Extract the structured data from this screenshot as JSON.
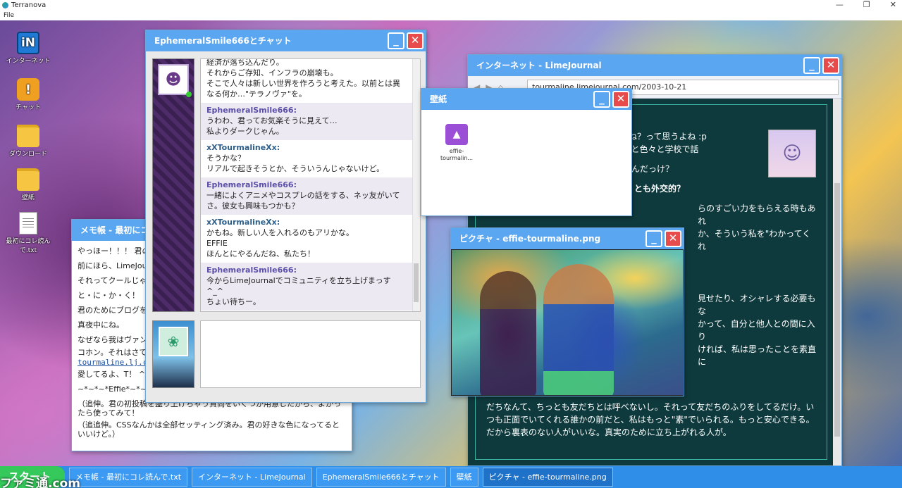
{
  "host": {
    "title": "Terranova",
    "menu_file": "File",
    "minimize": "—",
    "maximize": "❐",
    "close": "✕"
  },
  "desktop_icons": [
    {
      "label": "インターネット",
      "glyph": "iN"
    },
    {
      "label": "チャット",
      "glyph": "!"
    },
    {
      "label": "ダウンロード",
      "glyph": ""
    },
    {
      "label": "壁紙",
      "glyph": ""
    },
    {
      "label": "最初にコレ読んで.txt",
      "glyph": ""
    }
  ],
  "notepad": {
    "title": "メモ帳 - 最初にコレ読んで.txt",
    "lines": [
      "やっほー！！！ 君の",
      "前にほら、LimeJourn",
      "それってクールじゃ",
      "と・に・か・く！",
      "君のためにブログを",
      "真夜中にね。",
      "なぜなら我はヴァン",
      "コホン。それはさて",
      "tourmaline.lj.com",
      "愛してるよ、T！ ^_",
      "~*~*~*Effie*~*~*~"
    ],
    "ps1": "（追伸。君の初投稿を盛り上げちゃう質問をいくつか用意したから、よかったら使ってみて！",
    "ps2": "（追追伸。CSSなんかは全部セッティング済み。君の好きな色になってるといいけど。）"
  },
  "chat": {
    "title": "EphemeralSmile666とチャット",
    "top_text": "経済が落ち込んだり。\nそれからご存知、インフラの崩壊も。\nそこで人々は新しい世界を作ろうと考えた。以前とは異なる何か…\"テラノヴァ\"を。",
    "messages": [
      {
        "who": "EphemeralSmile666:",
        "text": "うわわ、君ってお気楽そうに見えて…\n私よりダークじゃん。"
      },
      {
        "who": "xXTourmalineXx:",
        "text": "そうかな？\nリアルで起きそうとか、そういうんじゃないけど。"
      },
      {
        "who": "EphemeralSmile666:",
        "text": "一緒によくアニメやコスプレの話をする、ネッ友がいてさ。彼女も興味もつかも？"
      },
      {
        "who": "xXTourmalineXx:",
        "text": "かもね。新しい人を入れるのもアリかな。\nEFFIE\nほんとにやるんだね、私たち！"
      },
      {
        "who": "EphemeralSmile666:",
        "text": "今からLimeJournalでコミュニティを立ち上げまっす ^_^\nちょい待ちー。"
      }
    ],
    "input_value": ""
  },
  "browser": {
    "title": "インターネット - LimeJournal",
    "url": "tourmaline.limejournal.com/2003-10-21",
    "para1": "ログとか遅くね？って思うよね :p\n！ これでもっと色々と学校で話",
    "para2": "くれたんだっけ？",
    "heading": "とも外交的？",
    "para3": "らのすごい力をもらえる時もあれ\nか、そういう私を\"わかってくれ",
    "para4": "見せたり、オシャレする必要もな\nかって、自分と他人との間に入り\nければ、私は思ったことを素直に",
    "para5": "だちなんて、ちっとも友だちとは呼べないし。それって友だちのふりをしてるだけ。いつも正面でいてくれる誰かの前だと、私はもっと\"素\"でいられる。もっと安心できる。だから裏表のない人がいいな。真実のために立ち上がれる人が。"
  },
  "wallpaper": {
    "title": "壁紙",
    "file_label": "effie-\ntourmalin..."
  },
  "picture": {
    "title": "ピクチャ - effie-tourmaline.png"
  },
  "taskbar": {
    "start": "スタート",
    "items": [
      "メモ帳 - 最初にコレ読んで.txt",
      "インターネット - LimeJournal",
      "EphemeralSmile666とチャット",
      "壁紙",
      "ピクチャ - effie-tourmaline.png"
    ],
    "watermark": "ファミ通.com"
  },
  "colors": {
    "titlebar": "#5aa6f0",
    "close": "#e74b4b",
    "taskbar": "#2f8fe8",
    "start": "#35c85a"
  }
}
